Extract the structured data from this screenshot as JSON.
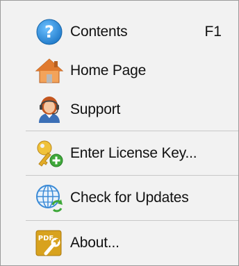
{
  "menu": {
    "items": [
      {
        "label": "Contents",
        "shortcut": "F1",
        "icon": "help-question-icon"
      },
      {
        "label": "Home Page",
        "shortcut": "",
        "icon": "home-icon"
      },
      {
        "label": "Support",
        "shortcut": "",
        "icon": "support-agent-icon"
      },
      {
        "label": "Enter License Key...",
        "shortcut": "",
        "icon": "license-key-icon"
      },
      {
        "label": "Check for Updates",
        "shortcut": "",
        "icon": "globe-update-icon"
      },
      {
        "label": "About...",
        "shortcut": "",
        "icon": "about-pdf-icon"
      }
    ],
    "about_icon_text": "PDF",
    "colors": {
      "background": "#f2f2f2",
      "border": "#9a9a9a",
      "separator": "#c8c8c8",
      "help_blue": "#2a8fd8",
      "home_orange": "#e9823a",
      "key_gold": "#e8b42a",
      "badge_green": "#3fa83a",
      "globe_blue": "#3a8ad6"
    }
  }
}
